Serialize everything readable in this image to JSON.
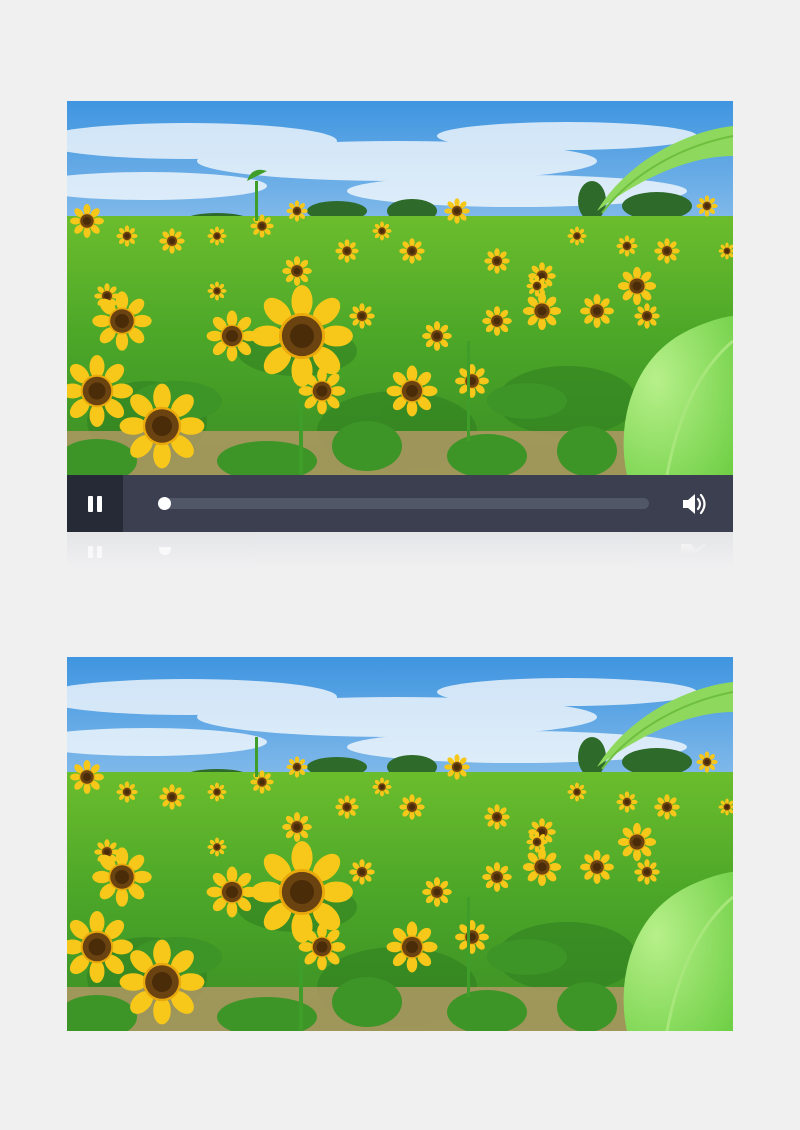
{
  "player": {
    "state": "playing",
    "progress": 0.0,
    "controls": {
      "pause_icon": "pause-icon",
      "volume_icon": "volume-icon"
    }
  },
  "scene": {
    "subject": "sunflower-field",
    "colors": {
      "sky_top": "#3f95e0",
      "sky_bottom": "#cfe6f6",
      "foliage": "#4fae2a",
      "petal": "#f7c81a",
      "center": "#6a4311",
      "leaf_foreground": "#8fe066"
    }
  },
  "theme": {
    "page_bg": "#f0f0f1",
    "control_bar": "#3b3f4f",
    "control_button_bg": "#262a36",
    "seek_track": "#525767"
  }
}
